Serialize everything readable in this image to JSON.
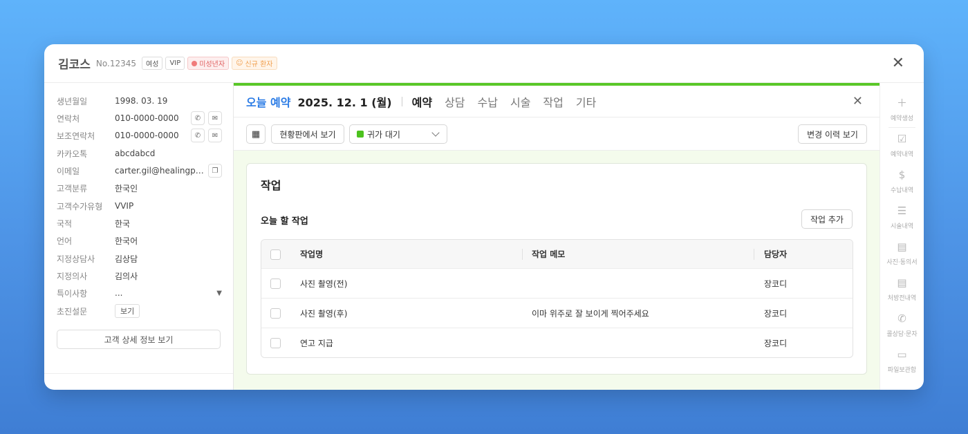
{
  "header": {
    "name": "김코스",
    "number": "No.12345",
    "tags": {
      "gender": "여성",
      "grade": "VIP",
      "minor": "미성년자",
      "new_patient": "신규 환자"
    }
  },
  "customer": {
    "fields": [
      {
        "label": "생년월일",
        "value": "1998. 03. 19"
      },
      {
        "label": "연락처",
        "value": "010-0000-0000"
      },
      {
        "label": "보조연락처",
        "value": "010-0000-0000"
      },
      {
        "label": "카카오톡",
        "value": "abcdabcd"
      },
      {
        "label": "이메일",
        "value": "carter.gil@healingpa..."
      },
      {
        "label": "고객분류",
        "value": "한국인"
      },
      {
        "label": "고객수가유형",
        "value": "VVIP"
      },
      {
        "label": "국적",
        "value": "한국"
      },
      {
        "label": "언어",
        "value": "한국어"
      },
      {
        "label": "지정상담사",
        "value": "김상담"
      },
      {
        "label": "지정의사",
        "value": "김의사"
      },
      {
        "label": "특이사항",
        "value": "..."
      },
      {
        "label": "초진설문",
        "value": "보기"
      }
    ],
    "detail_button": "고객 상세 정보 보기"
  },
  "main": {
    "today_label": "오늘 예약",
    "date": "2025. 12. 1 (월)",
    "tabs": [
      {
        "label": "예약",
        "active": true
      },
      {
        "label": "상담",
        "active": false
      },
      {
        "label": "수납",
        "active": false
      },
      {
        "label": "시술",
        "active": false
      },
      {
        "label": "작업",
        "active": false
      },
      {
        "label": "기타",
        "active": false
      }
    ],
    "toolbar": {
      "board_button": "현황판에서 보기",
      "status_value": "귀가 대기",
      "status_color": "#4cc21e",
      "history_button": "변경 이력 보기"
    },
    "card": {
      "title": "작업",
      "subtitle": "오늘 할 작업",
      "add_button": "작업 추가",
      "columns": [
        "작업명",
        "작업 메모",
        "담당자"
      ],
      "rows": [
        {
          "name": "사진 촬영(전)",
          "memo": "",
          "owner": "장코디"
        },
        {
          "name": "사진 촬영(후)",
          "memo": "이마 위주로 잘 보이게 찍어주세요",
          "owner": "장코디"
        },
        {
          "name": "연고 지급",
          "memo": "",
          "owner": "장코디"
        }
      ]
    }
  },
  "sidebar": {
    "items": [
      {
        "label": "예약생성",
        "icon": "plus-icon"
      },
      {
        "label": "예약내역",
        "icon": "calendar-check-icon"
      },
      {
        "label": "수납내역",
        "icon": "dollar-icon"
      },
      {
        "label": "시술내역",
        "icon": "list-icon"
      },
      {
        "label": "사진·동의서",
        "icon": "document-icon"
      },
      {
        "label": "처방전내역",
        "icon": "prescription-icon"
      },
      {
        "label": "콜상담·문자",
        "icon": "phone-icon"
      },
      {
        "label": "파일보관함",
        "icon": "folder-icon"
      }
    ]
  }
}
